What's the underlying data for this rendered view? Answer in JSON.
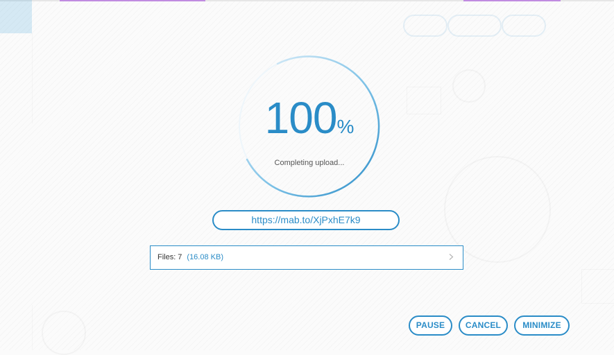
{
  "progress": {
    "value": 100,
    "percent_number": "100",
    "percent_sign": "%",
    "status": "Completing upload..."
  },
  "share": {
    "url": "https://mab.to/XjPxhE7k9"
  },
  "files": {
    "label": "Files:",
    "count": "7",
    "size": "(16.08 KB)"
  },
  "actions": {
    "pause": "PAUSE",
    "cancel": "CANCEL",
    "minimize": "MINIMIZE"
  },
  "colors": {
    "accent": "#2a8cc7",
    "ring_track": "#d8ecf7",
    "top_accent": "#c08be0"
  }
}
